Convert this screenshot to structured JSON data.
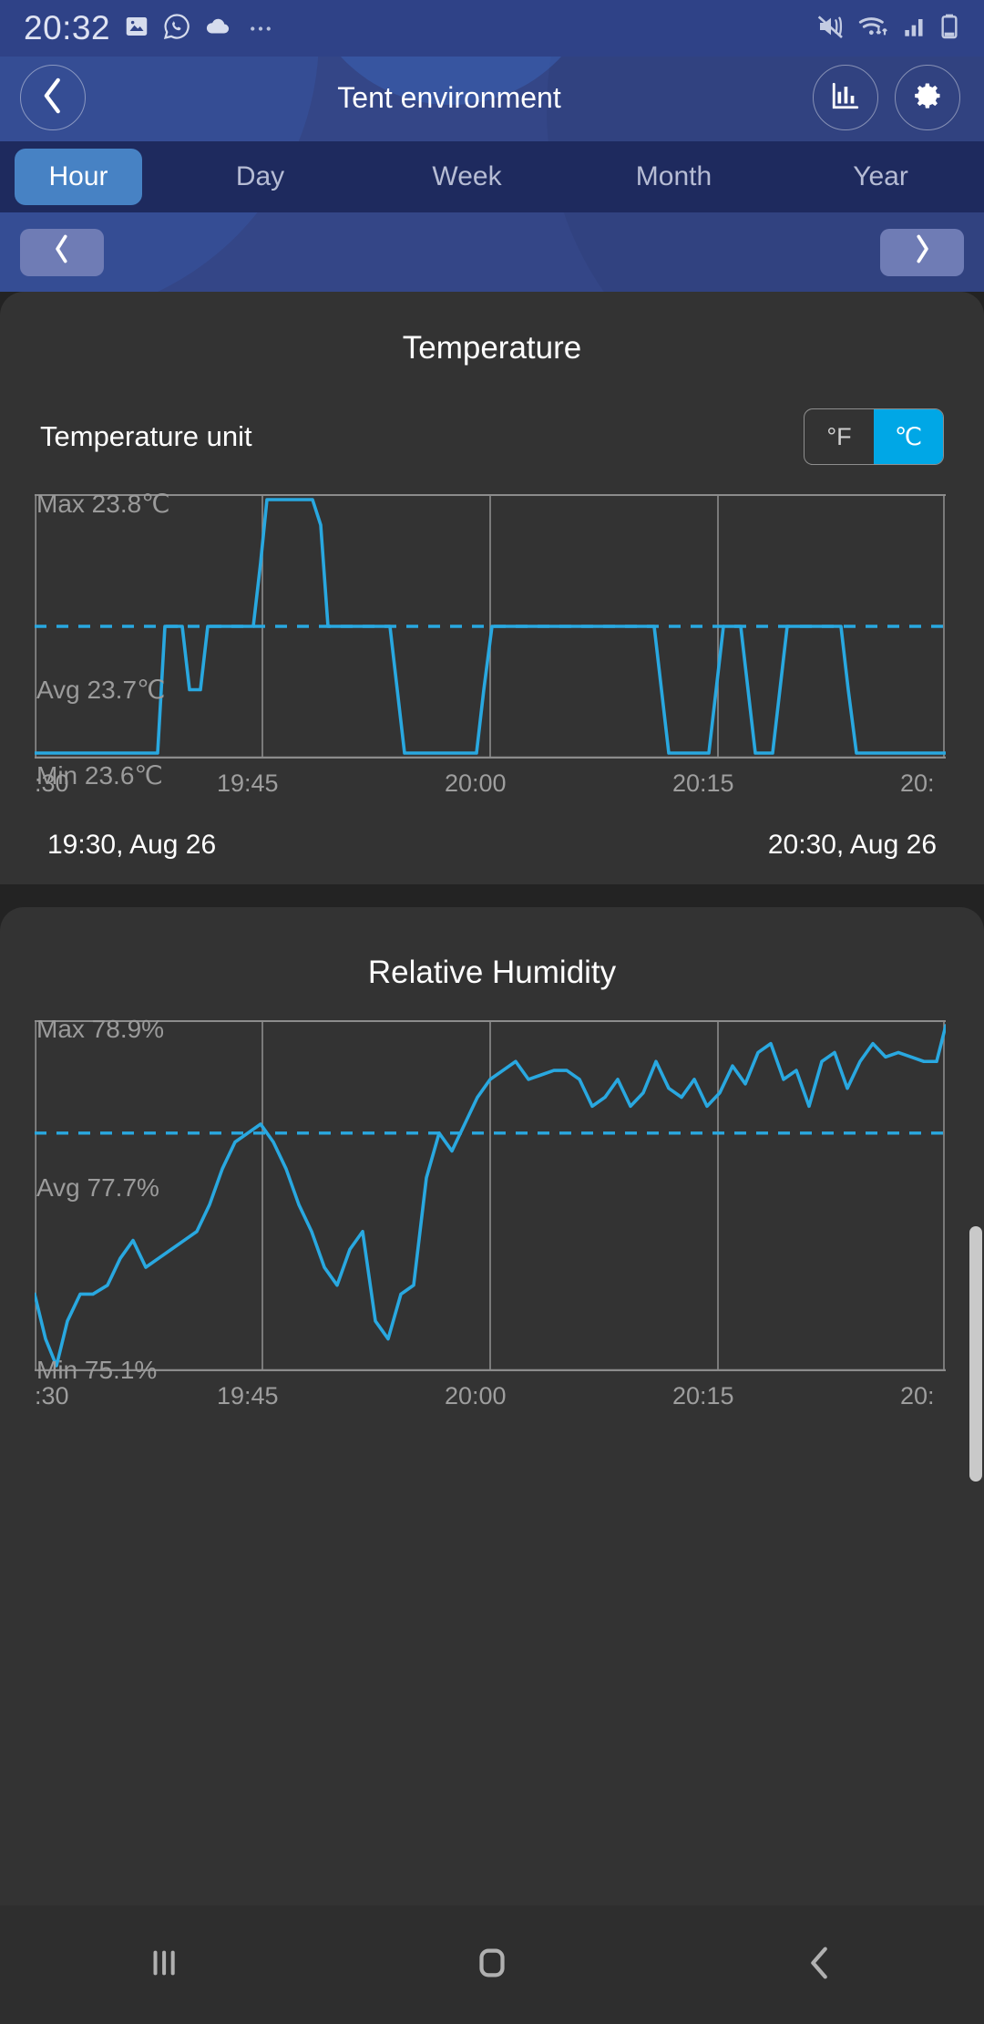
{
  "status_bar": {
    "clock": "20:32",
    "left_icons": [
      "photos-icon",
      "whatsapp-icon",
      "cloud-icon",
      "more-icon"
    ],
    "right_icons": [
      "vibrate-icon",
      "wifi-icon",
      "signal-icon",
      "battery-icon"
    ]
  },
  "header": {
    "title": "Tent environment",
    "back_icon": "chevron-left-icon",
    "chart_icon": "bar-chart-icon",
    "settings_icon": "gear-icon",
    "accent_blue": "#344687",
    "tab_active_color": "#4782c4"
  },
  "tabs": [
    {
      "label": "Hour",
      "active": true
    },
    {
      "label": "Day",
      "active": false
    },
    {
      "label": "Week",
      "active": false
    },
    {
      "label": "Month",
      "active": false
    },
    {
      "label": "Year",
      "active": false
    }
  ],
  "pager": {
    "prev_icon": "chevron-left-icon",
    "next_icon": "chevron-right-icon",
    "prev_label": "‹",
    "next_label": "›"
  },
  "temperature": {
    "title": "Temperature",
    "unit_row_label": "Temperature unit",
    "unit_options": [
      {
        "label": "°F",
        "selected": false
      },
      {
        "label": "℃",
        "selected": true
      }
    ],
    "max_label": "Max 23.8℃",
    "avg_label": "Avg 23.7℃",
    "min_label": "Min 23.6℃",
    "range_start": "19:30, Aug 26",
    "range_end": "20:30, Aug 26",
    "line_color": "#29a8e0"
  },
  "humidity": {
    "title": "Relative Humidity",
    "max_label": "Max 78.9%",
    "avg_label": "Avg 77.7%",
    "min_label": "Min 75.1%",
    "line_color": "#29a8e0"
  },
  "navbar": {
    "recents_icon": "recents-icon",
    "home_icon": "home-icon",
    "back_icon": "back-icon"
  },
  "chart_data": [
    {
      "type": "line",
      "title": "Temperature",
      "xlabel": "",
      "ylabel": "℃",
      "ylim": [
        23.6,
        23.8
      ],
      "xlim": [
        "19:30",
        "20:30"
      ],
      "grid": true,
      "legend": "none",
      "tick_labels": [
        ":30",
        "19:45",
        "20:00",
        "20:15",
        "20:"
      ],
      "tick_positions": [
        0,
        25,
        50,
        75,
        100
      ],
      "annotations": {
        "max": "Max 23.8℃",
        "avg": "Avg 23.7℃",
        "min": "Min 23.6℃",
        "avg_line_value": 23.7
      },
      "series": [
        {
          "name": "Temperature",
          "color": "#29a8e0",
          "x": [
            0,
            9,
            13.5,
            14.3,
            15.5,
            16.2,
            17,
            18.2,
            19,
            24,
            24.8,
            25.5,
            30.5,
            31.4,
            32.2,
            39,
            39.8,
            40.6,
            48.5,
            49.3,
            50.2,
            56.5,
            57.3,
            58,
            68,
            68.8,
            69.6,
            74,
            74.8,
            75.6,
            77.5,
            78.3,
            79.1,
            81,
            81.8,
            82.6,
            88.5,
            89.3,
            90.2,
            100
          ],
          "y": [
            23.6,
            23.6,
            23.6,
            23.7,
            23.7,
            23.7,
            23.65,
            23.65,
            23.7,
            23.7,
            23.75,
            23.8,
            23.8,
            23.78,
            23.7,
            23.7,
            23.65,
            23.6,
            23.6,
            23.65,
            23.7,
            23.7,
            23.7,
            23.7,
            23.7,
            23.65,
            23.6,
            23.6,
            23.65,
            23.7,
            23.7,
            23.65,
            23.6,
            23.6,
            23.65,
            23.7,
            23.7,
            23.65,
            23.6,
            23.6
          ]
        }
      ]
    },
    {
      "type": "line",
      "title": "Relative Humidity",
      "xlabel": "",
      "ylabel": "%",
      "ylim": [
        75.1,
        78.9
      ],
      "xlim": [
        "19:30",
        "20:30"
      ],
      "grid": true,
      "legend": "none",
      "tick_labels": [
        ":30",
        "19:45",
        "20:00",
        "20:15",
        "20:"
      ],
      "tick_positions": [
        0,
        25,
        50,
        75,
        100
      ],
      "annotations": {
        "max": "Max 78.9%",
        "avg": "Avg 77.7%",
        "min": "Min 75.1%",
        "avg_line_value": 77.7
      },
      "series": [
        {
          "name": "Relative Humidity",
          "color": "#29a8e0",
          "x": [
            0,
            1.2,
            2.4,
            3.6,
            5,
            6.4,
            8,
            9.4,
            10.8,
            12.2,
            13.6,
            15,
            16.4,
            17.8,
            19.2,
            20.6,
            22,
            23.4,
            24.8,
            26.2,
            27.6,
            29,
            30.4,
            31.8,
            33.2,
            34.6,
            36,
            37.4,
            38.8,
            40.2,
            41.6,
            43,
            44.4,
            45.8,
            47.2,
            48.6,
            50,
            51.4,
            52.8,
            54.2,
            55.6,
            57,
            58.4,
            59.8,
            61.2,
            62.6,
            64,
            65.4,
            66.8,
            68.2,
            69.6,
            71,
            72.4,
            73.8,
            75.2,
            76.6,
            78,
            79.4,
            80.8,
            82.2,
            83.6,
            85,
            86.4,
            87.8,
            89.2,
            90.6,
            92,
            93.4,
            94.8,
            96.2,
            97.6,
            99,
            100
          ],
          "y": [
            75.9,
            75.4,
            75.1,
            75.6,
            75.9,
            75.9,
            76.0,
            76.3,
            76.5,
            76.2,
            76.3,
            76.4,
            76.5,
            76.6,
            76.9,
            77.3,
            77.6,
            77.7,
            77.8,
            77.6,
            77.3,
            76.9,
            76.6,
            76.2,
            76.0,
            76.4,
            76.6,
            75.6,
            75.4,
            75.9,
            76.0,
            77.2,
            77.7,
            77.5,
            77.8,
            78.1,
            78.3,
            78.4,
            78.5,
            78.3,
            78.35,
            78.4,
            78.4,
            78.3,
            78.0,
            78.1,
            78.3,
            78.0,
            78.15,
            78.5,
            78.2,
            78.1,
            78.3,
            78.0,
            78.15,
            78.45,
            78.25,
            78.6,
            78.7,
            78.3,
            78.4,
            78.0,
            78.5,
            78.6,
            78.2,
            78.5,
            78.7,
            78.55,
            78.6,
            78.55,
            78.5,
            78.5,
            78.9
          ]
        }
      ]
    }
  ]
}
